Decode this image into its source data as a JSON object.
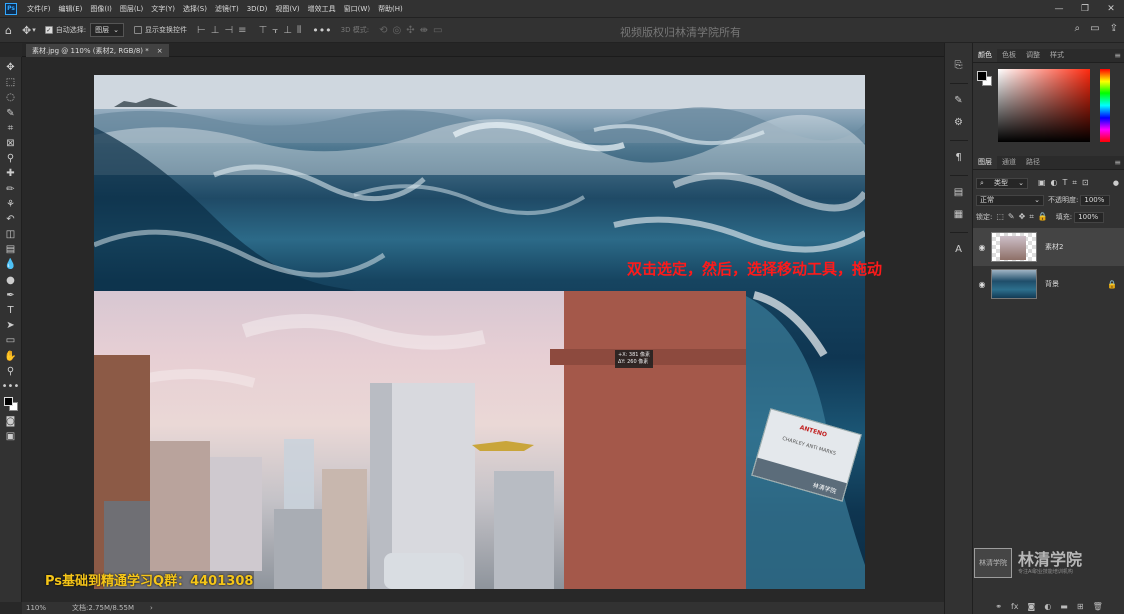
{
  "app": {
    "logo_text": "Ps"
  },
  "menu": [
    "文件(F)",
    "编辑(E)",
    "图像(I)",
    "图层(L)",
    "文字(Y)",
    "选择(S)",
    "滤镜(T)",
    "3D(D)",
    "视图(V)",
    "增效工具",
    "窗口(W)",
    "帮助(H)"
  ],
  "window_controls": {
    "minimize": "—",
    "restore": "❐",
    "close": "✕"
  },
  "options": {
    "auto_select_label": "自动选择:",
    "auto_select_checked": true,
    "auto_select_target": "图层",
    "show_transform_label": "显示变换控件",
    "show_transform_checked": false,
    "mode_3d_label": "3D 模式:",
    "more_glyph": "•••"
  },
  "watermark_top": "视频版权归林清学院所有",
  "document": {
    "tab_title": "素材.jpg @ 110% (素材2, RGB/8) *",
    "close_glyph": "×"
  },
  "canvas": {
    "annotation": "双击选定，然后，选择移动工具，拖动",
    "measure_line1": "+X: 381 像素",
    "measure_line2": "ΔY: 260 像素",
    "card_title": "ANTENO",
    "card_subtitle": "CHARLEY ANTI MARKS",
    "card_footer": "林清学院",
    "qq_group": "Ps基础到精通学习Q群：4401308"
  },
  "status": {
    "zoom": "110%",
    "doc_size": "文档:2.75M/8.55M",
    "arrow": "›"
  },
  "panels": {
    "color_tabs": [
      "颜色",
      "色板",
      "调整",
      "样式"
    ],
    "layers_tabs": [
      "图层",
      "通道",
      "路径"
    ],
    "filter_label": "类型",
    "blend_mode": "正常",
    "opacity_label": "不透明度:",
    "opacity_value": "100%",
    "lock_label": "锁定:",
    "fill_label": "填充:",
    "fill_value": "100%",
    "layers": [
      {
        "name": "素材2",
        "selected": true
      },
      {
        "name": "背景",
        "selected": false,
        "locked": true
      }
    ]
  },
  "logo": {
    "mark_text": "林清学院",
    "name": "林清学院",
    "subtitle": "专注AI职业技能培训机构"
  },
  "colors": {
    "annotation_red": "#ff1a1a",
    "qq_yellow": "#f5c518",
    "accent_blue": "#31a8ff"
  }
}
